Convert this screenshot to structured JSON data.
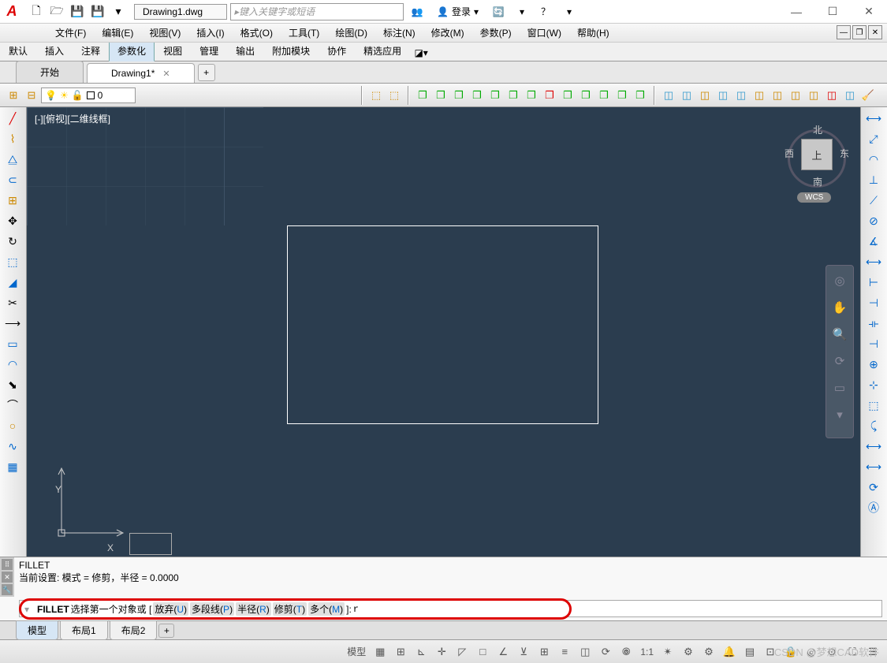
{
  "title_bar": {
    "doc_name": "Drawing1.dwg",
    "search_placeholder": "键入关键字或短语",
    "login_label": "登录"
  },
  "menus": [
    "文件(F)",
    "编辑(E)",
    "视图(V)",
    "插入(I)",
    "格式(O)",
    "工具(T)",
    "绘图(D)",
    "标注(N)",
    "修改(M)",
    "参数(P)",
    "窗口(W)",
    "帮助(H)"
  ],
  "ribbon_tabs": [
    "默认",
    "插入",
    "注释",
    "参数化",
    "视图",
    "管理",
    "输出",
    "附加模块",
    "协作",
    "精选应用"
  ],
  "ribbon_active_index": 3,
  "doc_tabs": {
    "items": [
      {
        "label": "开始",
        "active": false,
        "closable": false
      },
      {
        "label": "Drawing1*",
        "active": true,
        "closable": true
      }
    ]
  },
  "layer": {
    "name": "0"
  },
  "viewport": {
    "label": "[-][俯视][二维线框]",
    "cube": {
      "n": "北",
      "s": "南",
      "e": "东",
      "w": "西",
      "top": "上"
    },
    "wcs": "WCS",
    "ucs_x": "X",
    "ucs_y": "Y"
  },
  "command": {
    "history_line1": "FILLET",
    "history_line2": "当前设置: 模式 = 修剪，半径 = 0.0000",
    "prompt_cmd": "FILLET",
    "prompt_text1": "选择第一个对象或 [",
    "opts": [
      {
        "label": "放弃",
        "key": "U"
      },
      {
        "label": "多段线",
        "key": "P"
      },
      {
        "label": "半径",
        "key": "R"
      },
      {
        "label": "修剪",
        "key": "T"
      },
      {
        "label": "多个",
        "key": "M"
      }
    ],
    "prompt_text2": "]:",
    "input_value": "r"
  },
  "sheet_tabs": [
    "模型",
    "布局1",
    "布局2"
  ],
  "sheet_active_index": 0,
  "status": {
    "model_btn": "模型",
    "scale": "1:1"
  },
  "watermark": "CSDN @梦想CAD软件"
}
